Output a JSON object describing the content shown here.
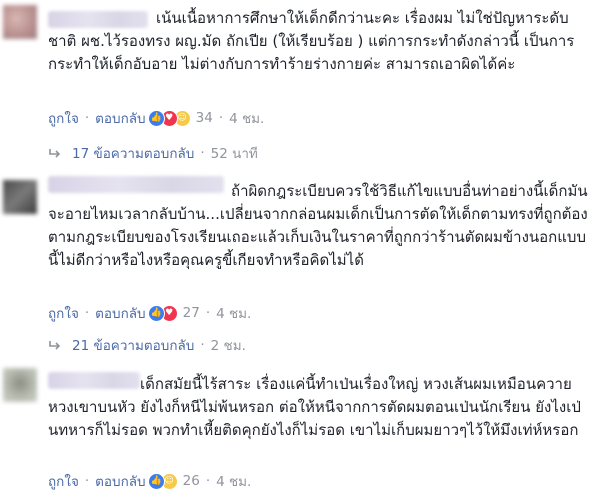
{
  "comments": [
    {
      "text": "เน้นเนื้อหาการศึกษาให้เด็กดีกว่านะคะ เรื่องผม ไม่ใช่ปัญหาระดับชาติ ผช.ไว้รองทรง ผญ.มัด ถักเปีย (ให้เรียบร้อย ) แต่การกระทำดังกล่าวนี้ เป็นการกระทำให้เด็กอับอาย ไม่ต่างกับการทำร้ายร่างกายค่ะ สามารถเอาผิดได้ค่ะ",
      "like_label": "ถูกใจ",
      "reply_label": "ตอบกลับ",
      "reaction_count": "34",
      "time": "4 ชม.",
      "replies_count": "17 ข้อความตอบกลับ",
      "replies_age": "52 นาที"
    },
    {
      "text": "ถ้าผิดกฎระเบียบควรใช้วิธีแก้ไขแบบอื่นท่าอย่างนี้เด็กมันจะอายไหมเวลากลับบ้าน...เปลี่ยนจากกล่อนผมเด็กเป็นการตัดให้เด็กตามทรงที่ถูกต้องตามกฎระเบียบของโรงเรียนเถอะแล้วเก็บเงินในราคาที่ถูกกว่าร้านตัดผมข้างนอกแบบนี้ไม่ดีกว่าหรือไงหรือคุณครูขี้เกียจทำหรือคิดไม่ได้",
      "like_label": "ถูกใจ",
      "reply_label": "ตอบกลับ",
      "reaction_count": "27",
      "time": "4 ชม.",
      "replies_count": "21 ข้อความตอบกลับ",
      "replies_age": "2 ชม."
    },
    {
      "text": "เด็กสมัยนี้ไร้สาระ เรื่องแค่นี้ทำเป่นเรื่องใหญ่ หวงเส้นผมเหมือนควายหวงเขาบนหัว ยังไงก็หนีไม่พ้นหรอก ต่อให้หนีจากการตัดผมตอนเป่นนักเรียน ยังไงเป่นทหารก็ไม่รอด พวกทำเหี้ยติดคุกยังไงก็ไม่รอด เขาไม่เก็บผมยาวๆไว้ให้มึงเท่ห์หรอก",
      "like_label": "ถูกใจ",
      "reply_label": "ตอบกลับ",
      "reaction_count": "26",
      "time": "4 ชม."
    }
  ],
  "colors": {
    "link": "#4b6aa8",
    "meta": "#90949c",
    "text": "#1d2129",
    "like": "#3b7cf0",
    "love": "#f0364f",
    "haha": "#f7c948"
  }
}
